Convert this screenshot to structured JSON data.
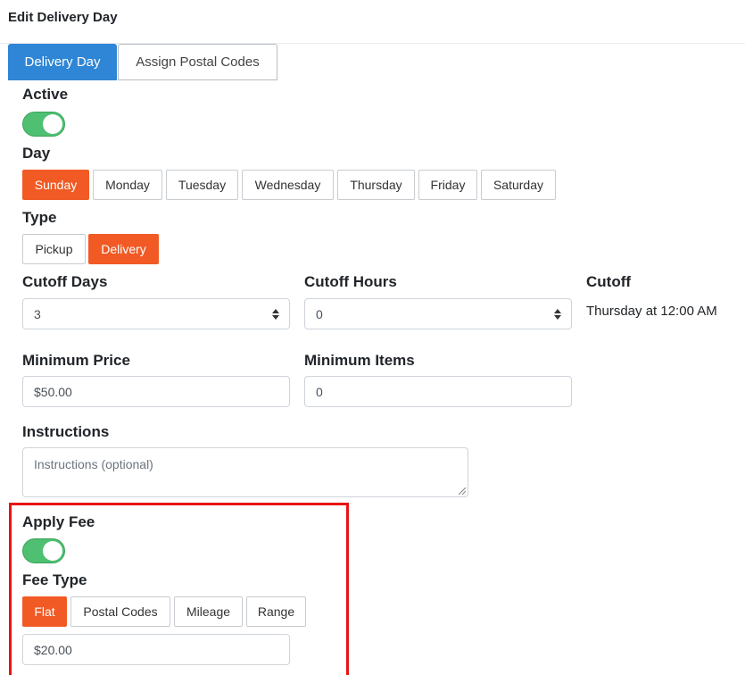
{
  "header": {
    "title": "Edit Delivery Day"
  },
  "tabs": [
    {
      "label": "Delivery Day",
      "active": true
    },
    {
      "label": "Assign Postal Codes",
      "active": false
    }
  ],
  "active": {
    "label": "Active",
    "on": true
  },
  "day": {
    "label": "Day",
    "options": [
      "Sunday",
      "Monday",
      "Tuesday",
      "Wednesday",
      "Thursday",
      "Friday",
      "Saturday"
    ],
    "selected": "Sunday"
  },
  "type": {
    "label": "Type",
    "options": [
      "Pickup",
      "Delivery"
    ],
    "selected": "Delivery"
  },
  "cutoff_days": {
    "label": "Cutoff Days",
    "value": "3"
  },
  "cutoff_hours": {
    "label": "Cutoff Hours",
    "value": "0"
  },
  "cutoff": {
    "label": "Cutoff",
    "value": "Thursday at 12:00 AM"
  },
  "minimum_price": {
    "label": "Minimum Price",
    "value": "$50.00"
  },
  "minimum_items": {
    "label": "Minimum Items",
    "value": "0"
  },
  "instructions": {
    "label": "Instructions",
    "placeholder": "Instructions (optional)"
  },
  "apply_fee": {
    "label": "Apply Fee",
    "on": true
  },
  "fee_type": {
    "label": "Fee Type",
    "options": [
      "Flat",
      "Postal Codes",
      "Mileage",
      "Range"
    ],
    "selected": "Flat"
  },
  "fee_amount": {
    "value": "$20.00"
  },
  "colors": {
    "accent": "#f15a24",
    "tab_active": "#2f86d6",
    "toggle_on": "#4fbf72",
    "highlight": "#e81414"
  }
}
